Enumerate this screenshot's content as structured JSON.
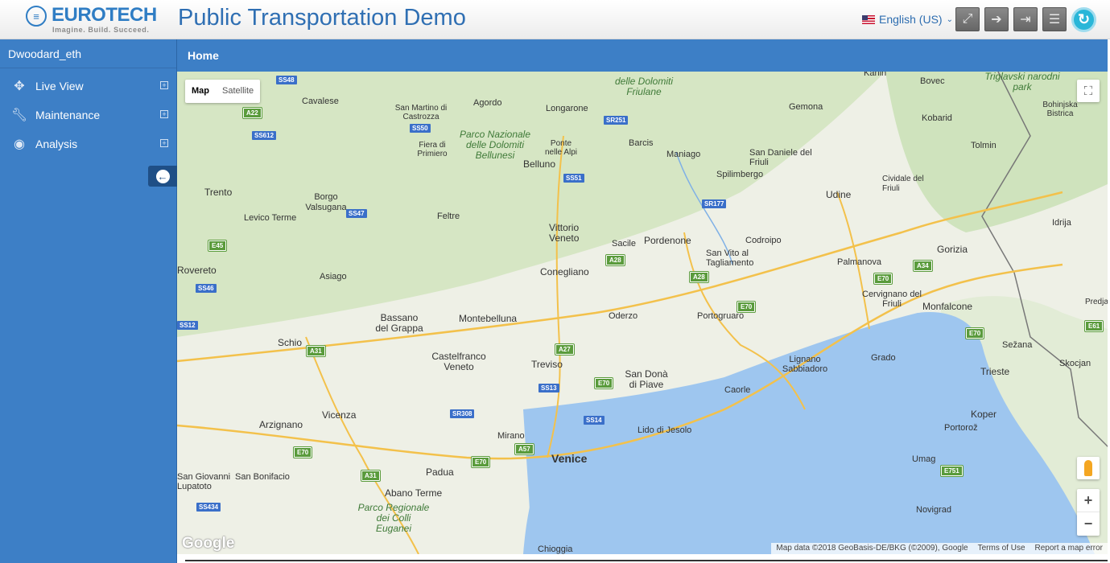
{
  "header": {
    "logo_name": "EUROTECH",
    "logo_tagline": "Imagine. Build. Succeed.",
    "app_title": "Public Transportation Demo",
    "language": "English (US)",
    "buttons": [
      "fullscreen-icon",
      "login-icon",
      "logout-icon",
      "menu-icon"
    ]
  },
  "sidebar": {
    "user": "Dwoodard_eth",
    "items": [
      {
        "label": "Live View",
        "icon": "crosshair-icon"
      },
      {
        "label": "Maintenance",
        "icon": "wrench-icon"
      },
      {
        "label": "Analysis",
        "icon": "eye-icon"
      }
    ]
  },
  "breadcrumb": {
    "current": "Home"
  },
  "map": {
    "type_map": "Map",
    "type_satellite": "Satellite",
    "google": "Google",
    "attribution": "Map data ©2018 GeoBasis-DE/BKG (©2009), Google",
    "terms": "Terms of Use",
    "report": "Report a map error",
    "cities": [
      "Trento",
      "Cavalese",
      "Agordo",
      "Longarone",
      "Belluno",
      "Feltre",
      "Vittorio Veneto",
      "Conegliano",
      "Sacile",
      "Pordenone",
      "Maniago",
      "Spilimbergo",
      "San Daniele del Friuli",
      "Gemona",
      "Udine",
      "Cividale del Friuli",
      "Gorizia",
      "Palmanova",
      "Codroipo",
      "San Vito al Tagliamento",
      "Portogruaro",
      "Oderzo",
      "Montebelluna",
      "Bassano del Grappa",
      "Asiago",
      "Schio",
      "Vicenza",
      "Castelfranco Veneto",
      "Treviso",
      "San Donà di Piave",
      "Mirano",
      "Venice",
      "Padua",
      "Abano Terme",
      "Chioggia",
      "Lido di Jesolo",
      "Caorle",
      "Lignano Sabbiadoro",
      "Grado",
      "Monfalcone",
      "Cervignano del Friuli",
      "Trieste",
      "Koper",
      "Portorož",
      "Umag",
      "Novigrad",
      "Sežana",
      "Kobarid",
      "Tolmin",
      "Bovec",
      "Arzignano",
      "Rovereto",
      "San Bonifacio",
      "Borgo Valsugana",
      "Levico Terme",
      "Fiera di Primiero",
      "San Martino di Castrozza",
      "Ponte nelle Alpi",
      "Barcis",
      "Idrija",
      "Bohinjska Bistrica",
      "Kanin",
      "Skocjan",
      "Predjama",
      "San Giovanni Lupatoto"
    ],
    "parks": [
      "Parco Nazionale delle Dolomiti Bellunesi",
      "Parco Regionale dei Colli Euganei",
      "delle Dolomiti Friulane",
      "Triglavski narodni park"
    ]
  }
}
